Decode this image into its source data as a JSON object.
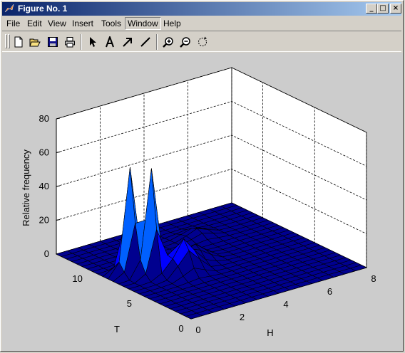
{
  "window": {
    "title": "Figure No. 1"
  },
  "menu": [
    "File",
    "Edit",
    "View",
    "Insert",
    "Tools",
    "Window",
    "Help"
  ],
  "toolbar": [
    "new-file-icon",
    "open-folder-icon",
    "save-icon",
    "print-icon",
    "select-arrow-icon",
    "insert-text-icon",
    "insert-arrow-icon",
    "insert-line-icon",
    "zoom-in-icon",
    "zoom-out-icon",
    "rotate-3d-icon"
  ],
  "chart_data": {
    "type": "surface",
    "xlabel": "H",
    "ylabel": "T",
    "zlabel": "Relative frequency",
    "x_ticks": [
      "0",
      "2",
      "4",
      "6",
      "8"
    ],
    "y_ticks": [
      "0",
      "5",
      "10"
    ],
    "z_ticks": [
      "0",
      "20",
      "40",
      "60",
      "80"
    ],
    "xlim": [
      0,
      8
    ],
    "ylim": [
      0,
      13
    ],
    "zlim": [
      0,
      80
    ],
    "grid": true,
    "colormap": [
      "#00008f",
      "#0000ff",
      "#0060ff",
      "#00bfff",
      "#ffff00"
    ],
    "peaks": [
      {
        "H": 1,
        "T": 8,
        "value": 62
      },
      {
        "H": 1.5,
        "T": 7,
        "value": 62
      },
      {
        "H": 2.5,
        "T": 6,
        "value": 20
      },
      {
        "H": 3.5,
        "T": 7,
        "value": 10
      },
      {
        "H": 5,
        "T": 10,
        "value": 5
      }
    ]
  }
}
